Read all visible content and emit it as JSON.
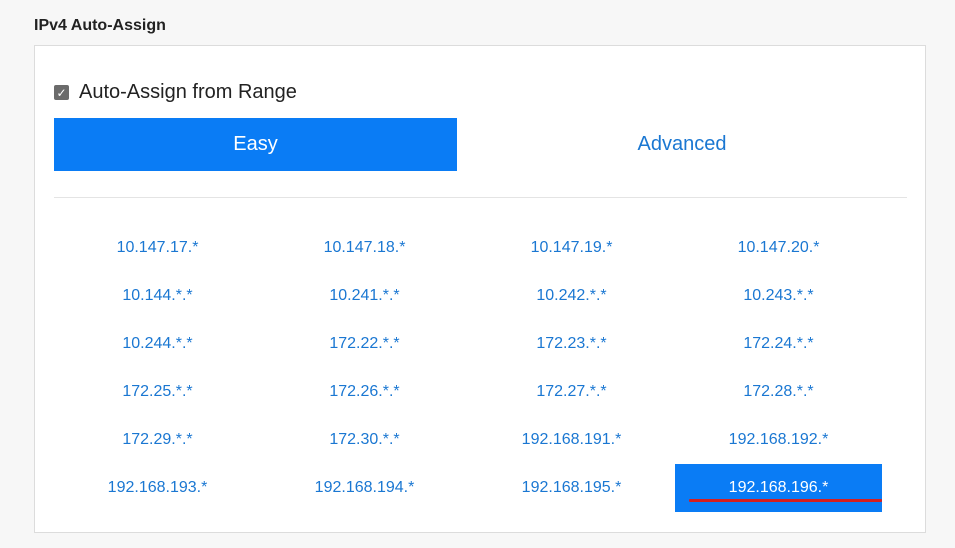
{
  "section": {
    "title": "IPv4 Auto-Assign"
  },
  "auto_assign": {
    "label": "Auto-Assign from Range",
    "checked": true
  },
  "tabs": [
    {
      "label": "Easy",
      "active": true
    },
    {
      "label": "Advanced",
      "active": false
    }
  ],
  "ranges": [
    "10.147.17.*",
    "10.147.18.*",
    "10.147.19.*",
    "10.147.20.*",
    "10.144.*.*",
    "10.241.*.*",
    "10.242.*.*",
    "10.243.*.*",
    "10.244.*.*",
    "172.22.*.*",
    "172.23.*.*",
    "172.24.*.*",
    "172.25.*.*",
    "172.26.*.*",
    "172.27.*.*",
    "172.28.*.*",
    "172.29.*.*",
    "172.30.*.*",
    "192.168.191.*",
    "192.168.192.*",
    "192.168.193.*",
    "192.168.194.*",
    "192.168.195.*",
    "192.168.196.*"
  ],
  "selected_range": "192.168.196.*",
  "colors": {
    "accent": "#0a7cf5",
    "link": "#1a77d2",
    "annotation": "#d61f1f"
  }
}
